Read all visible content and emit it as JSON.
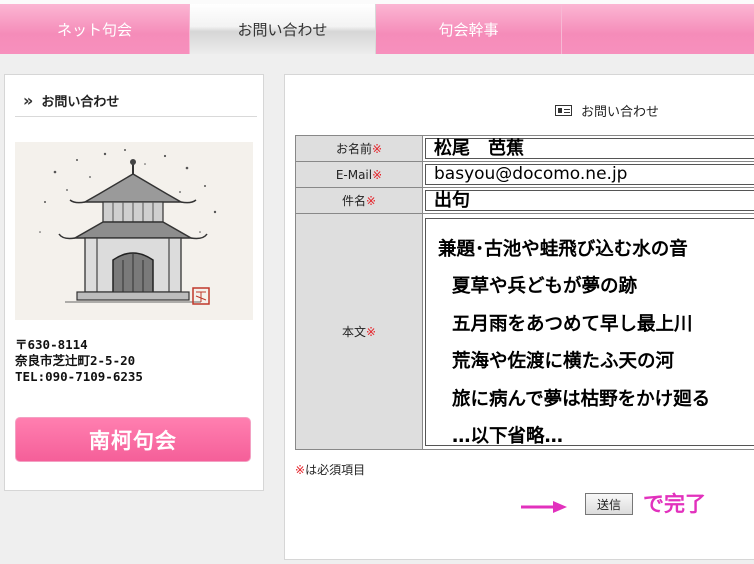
{
  "nav": {
    "tabs": [
      {
        "label": "ネット句会"
      },
      {
        "label": "お問い合わせ"
      },
      {
        "label": "句会幹事"
      }
    ]
  },
  "sidebar": {
    "heading": "お問い合わせ",
    "address": {
      "postal": "〒630-8114",
      "street": "奈良市芝辻町2-5-20",
      "tel": "TEL:090-7109-6235"
    },
    "button_label": "南柯句会"
  },
  "form": {
    "title": "お問い合わせ",
    "required_mark": "※",
    "fields": {
      "name": {
        "label": "お名前",
        "value": "松尾　芭蕉"
      },
      "email": {
        "label": "E-Mail",
        "value": "basyou@docomo.ne.jp"
      },
      "subject": {
        "label": "件名",
        "value": "出句"
      },
      "body": {
        "label": "本文",
        "lines": [
          "兼題･古池や蛙飛び込む水の音",
          "夏草や兵どもが夢の跡",
          "五月雨をあつめて早し最上川",
          "荒海や佐渡に横たふ天の河",
          "旅に病んで夢は枯野をかけ廻る",
          "…以下省略…"
        ]
      }
    },
    "required_note": "は必須項目",
    "submit_label": "送信",
    "done_text": "で完了"
  },
  "colors": {
    "accent_pink": "#f58cb9",
    "button_pink": "#f55f99",
    "required_red": "#e5242b",
    "annotation_magenta": "#e231bd"
  }
}
